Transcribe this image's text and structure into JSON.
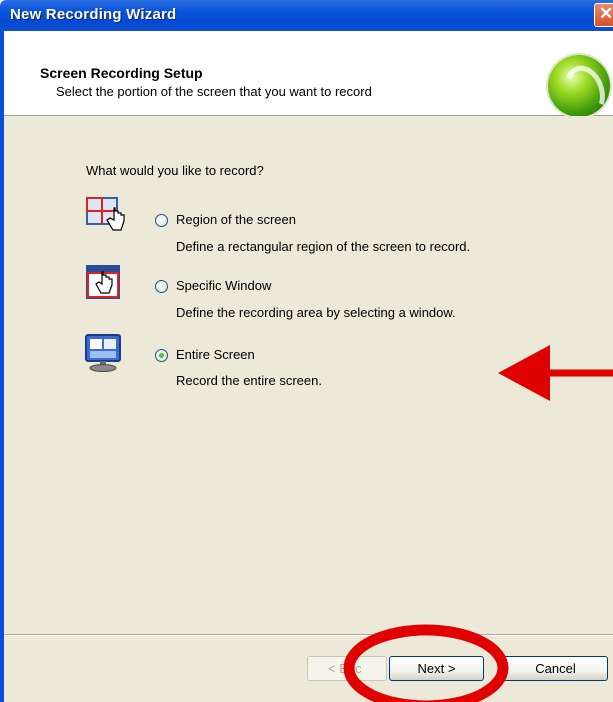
{
  "window": {
    "title": "New Recording Wizard",
    "close_glyph": "✕"
  },
  "header": {
    "title": "Screen Recording Setup",
    "subtitle": "Select the portion of the screen that you want to record",
    "logo_icon": "green-orb-logo-icon"
  },
  "question": "What would you like to record?",
  "options": [
    {
      "label": "Region of the screen",
      "description": "Define a rectangular region of the screen to record.",
      "selected": false,
      "icon": "region-select-icon"
    },
    {
      "label": "Specific Window",
      "description": "Define the recording area by selecting a window.",
      "selected": false,
      "icon": "window-select-icon"
    },
    {
      "label": "Entire Screen",
      "description": "Record the entire screen.",
      "selected": true,
      "icon": "monitor-icon"
    }
  ],
  "buttons": {
    "back": "< Back",
    "back_visible": "< Bac",
    "next": "Next >",
    "cancel": "Cancel"
  },
  "annotations": {
    "arrow_color": "#e00000",
    "circle_color": "#e00000"
  }
}
